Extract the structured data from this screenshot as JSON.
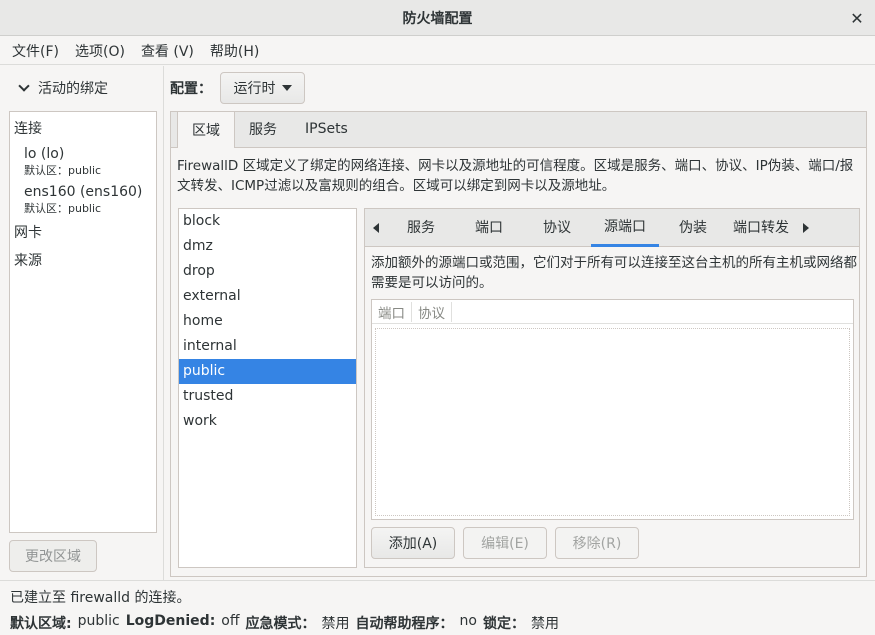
{
  "window": {
    "title": "防火墙配置"
  },
  "menu": [
    "文件(F)",
    "选项(O)",
    "查看 (V)",
    "帮助(H)"
  ],
  "bindings": {
    "header": "活动的绑定",
    "categories": {
      "connections": "连接",
      "nics": "网卡",
      "sources": "来源"
    },
    "connections": [
      {
        "name": "lo (lo)",
        "zone": "默认区：public"
      },
      {
        "name": "ens160 (ens160)",
        "zone": "默认区：public"
      }
    ],
    "change_zone_button": "更改区域"
  },
  "config": {
    "label": "配置：",
    "value": "运行时"
  },
  "top_tabs": [
    "区域",
    "服务",
    "IPSets"
  ],
  "zone_description": "FirewallD 区域定义了绑定的网络连接、网卡以及源地址的可信程度。区域是服务、端口、协议、IP伪装、端口/报文转发、ICMP过滤以及富规则的组合。区域可以绑定到网卡以及源地址。",
  "zones": [
    "block",
    "dmz",
    "drop",
    "external",
    "home",
    "internal",
    "public",
    "trusted",
    "work"
  ],
  "selected_zone": "public",
  "zone_tabs": [
    "服务",
    "端口",
    "协议",
    "源端口",
    "伪装",
    "端口转发"
  ],
  "active_zone_tab": "源端口",
  "source_port_description": "添加额外的源端口或范围，它们对于所有可以连接至这台主机的所有主机或网络都需要是可以访问的。",
  "port_table": {
    "columns": [
      "端口",
      "协议"
    ],
    "rows": []
  },
  "buttons": {
    "add": "添加(A)",
    "edit": "编辑(E)",
    "remove": "移除(R)"
  },
  "status": {
    "connection": "已建立至 firewalld 的连接。",
    "default_zone_label": "默认区域:",
    "default_zone_value": "public",
    "log_denied_label": "LogDenied:",
    "log_denied_value": "off",
    "panic_label": "应急模式：",
    "panic_value": "禁用",
    "helper_label": "自动帮助程序：",
    "helper_value": "no",
    "lockdown_label": "锁定：",
    "lockdown_value": "禁用"
  },
  "colors": {
    "accent": "#3584e4"
  }
}
